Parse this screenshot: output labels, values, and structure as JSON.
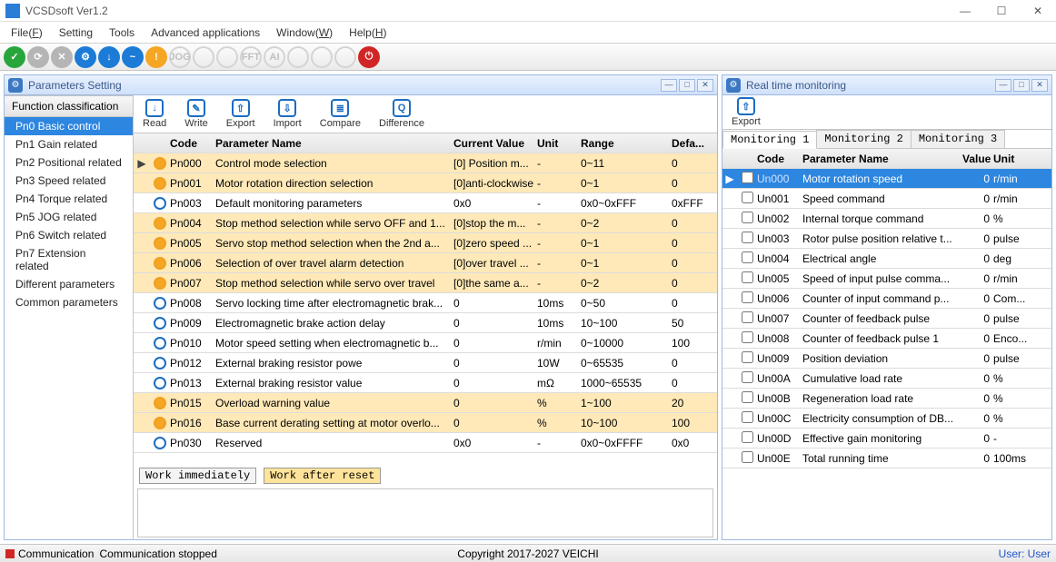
{
  "window": {
    "title": "VCSDsoft Ver1.2"
  },
  "menu": {
    "file": "File(F)",
    "setting": "Setting",
    "tools": "Tools",
    "advanced": "Advanced applications",
    "window": "Window(W)",
    "help": "Help(H)"
  },
  "tool_icons": [
    "✓",
    "⟳",
    "✕",
    "⚙",
    "↓",
    "~",
    "!",
    "JOG",
    "",
    "",
    "FFT",
    "AI",
    "",
    "",
    ""
  ],
  "panel_params": {
    "title": "Parameters Setting"
  },
  "panel_rt": {
    "title": "Real time monitoring"
  },
  "sidebar": {
    "head": "Function classification",
    "items": [
      "Pn0 Basic control",
      "Pn1 Gain related",
      "Pn2 Positional related",
      "Pn3 Speed related",
      "Pn4 Torque related",
      "Pn5 JOG related",
      "Pn6 Switch related",
      "Pn7 Extension related",
      "Different parameters",
      "Common parameters"
    ],
    "selected": 0
  },
  "board": {
    "read": "Read",
    "write": "Write",
    "export": "Export",
    "import": "Import",
    "compare": "Compare",
    "diff": "Difference"
  },
  "grid": {
    "head": {
      "code": "Code",
      "name": "Parameter Name",
      "val": "Current Value",
      "unit": "Unit",
      "range": "Range",
      "def": "Defa..."
    },
    "rows": [
      {
        "alt": 1,
        "mark": "▶",
        "code": "Pn000",
        "name": "Control mode selection",
        "val": "[0] Position m...",
        "unit": "-",
        "range": "0~11",
        "def": "0"
      },
      {
        "alt": 1,
        "code": "Pn001",
        "name": "Motor rotation direction selection",
        "val": "[0]anti-clockwise",
        "unit": "-",
        "range": "0~1",
        "def": "0"
      },
      {
        "alt": 0,
        "code": "Pn003",
        "name": "Default monitoring parameters",
        "val": "0x0",
        "unit": "-",
        "range": "0x0~0xFFF",
        "def": "0xFFF"
      },
      {
        "alt": 1,
        "code": "Pn004",
        "name": "Stop method selection while servo OFF and 1...",
        "val": "[0]stop the m...",
        "unit": "-",
        "range": "0~2",
        "def": "0"
      },
      {
        "alt": 1,
        "code": "Pn005",
        "name": "Servo stop method selection when the 2nd a...",
        "val": "[0]zero speed ...",
        "unit": "-",
        "range": "0~1",
        "def": "0"
      },
      {
        "alt": 1,
        "code": "Pn006",
        "name": "Selection of over travel alarm detection",
        "val": "[0]over travel ...",
        "unit": "-",
        "range": "0~1",
        "def": "0"
      },
      {
        "alt": 1,
        "code": "Pn007",
        "name": "Stop method selection while servo over travel",
        "val": "[0]the same a...",
        "unit": "-",
        "range": "0~2",
        "def": "0"
      },
      {
        "alt": 0,
        "code": "Pn008",
        "name": "Servo locking time after electromagnetic brak...",
        "val": "0",
        "unit": "10ms",
        "range": "0~50",
        "def": "0"
      },
      {
        "alt": 0,
        "code": "Pn009",
        "name": "Electromagnetic brake action delay",
        "val": "0",
        "unit": "10ms",
        "range": "10~100",
        "def": "50"
      },
      {
        "alt": 0,
        "code": "Pn010",
        "name": "Motor speed setting when electromagnetic b...",
        "val": "0",
        "unit": "r/min",
        "range": "0~10000",
        "def": "100"
      },
      {
        "alt": 0,
        "code": "Pn012",
        "name": "External braking resistor powe",
        "val": "0",
        "unit": "10W",
        "range": "0~65535",
        "def": "0"
      },
      {
        "alt": 0,
        "code": "Pn013",
        "name": "External braking resistor value",
        "val": "0",
        "unit": "mΩ",
        "range": "1000~65535",
        "def": "0"
      },
      {
        "alt": 1,
        "code": "Pn015",
        "name": "Overload warning value",
        "val": "0",
        "unit": "%",
        "range": "1~100",
        "def": "20"
      },
      {
        "alt": 1,
        "code": "Pn016",
        "name": "Base current derating setting at motor overlo...",
        "val": "0",
        "unit": "%",
        "range": "10~100",
        "def": "100"
      },
      {
        "alt": 0,
        "code": "Pn030",
        "name": "Reserved",
        "val": "0x0",
        "unit": "-",
        "range": "0x0~0xFFFF",
        "def": "0x0"
      }
    ]
  },
  "bottom": {
    "work_imm": "Work immediately",
    "work_after": "Work after reset"
  },
  "rt": {
    "export": "Export",
    "tabs": [
      "Monitoring 1",
      "Monitoring 2",
      "Monitoring 3"
    ],
    "active_tab": 0,
    "head": {
      "code": "Code",
      "name": "Parameter Name",
      "val": "Value",
      "unit": "Unit"
    },
    "rows": [
      {
        "sel": 1,
        "mark": "▶",
        "code": "Un000",
        "name": "Motor rotation speed",
        "val": "0",
        "unit": "r/min"
      },
      {
        "code": "Un001",
        "name": "Speed command",
        "val": "0",
        "unit": "r/min"
      },
      {
        "code": "Un002",
        "name": "Internal torque command",
        "val": "0",
        "unit": "%"
      },
      {
        "code": "Un003",
        "name": "Rotor pulse position relative t...",
        "val": "0",
        "unit": "pulse"
      },
      {
        "code": "Un004",
        "name": "Electrical angle",
        "val": "0",
        "unit": "deg"
      },
      {
        "code": "Un005",
        "name": "Speed of input pulse comma...",
        "val": "0",
        "unit": "r/min"
      },
      {
        "code": "Un006",
        "name": "Counter of input command p...",
        "val": "0",
        "unit": "Com..."
      },
      {
        "code": "Un007",
        "name": "Counter of feedback pulse",
        "val": "0",
        "unit": "pulse"
      },
      {
        "code": "Un008",
        "name": "Counter of feedback pulse 1",
        "val": "0",
        "unit": "Enco..."
      },
      {
        "code": "Un009",
        "name": "Position deviation",
        "val": "0",
        "unit": "pulse"
      },
      {
        "code": "Un00A",
        "name": "Cumulative load rate",
        "val": "0",
        "unit": "%"
      },
      {
        "code": "Un00B",
        "name": "Regeneration load rate",
        "val": "0",
        "unit": "%"
      },
      {
        "code": "Un00C",
        "name": "Electricity consumption of DB...",
        "val": "0",
        "unit": "%"
      },
      {
        "code": "Un00D",
        "name": "Effective gain monitoring",
        "val": "0",
        "unit": "-"
      },
      {
        "code": "Un00E",
        "name": "Total running time",
        "val": "0",
        "unit": "100ms"
      }
    ]
  },
  "status": {
    "comm_label": "Communication",
    "comm_state": "Communication stopped",
    "copyright": "Copyright 2017-2027 VEICHI",
    "user": "User: User"
  }
}
